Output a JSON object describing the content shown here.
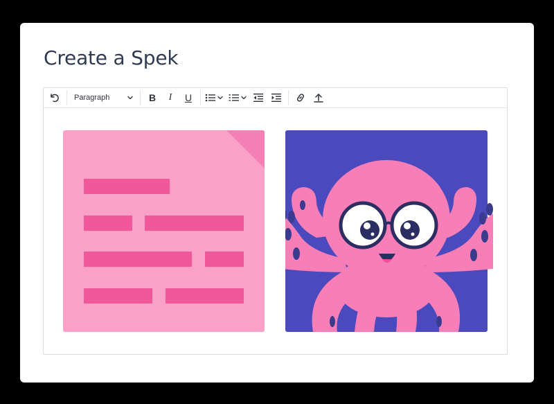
{
  "page": {
    "title": "Create a Spek"
  },
  "toolbar": {
    "items": {
      "undo": "undo-icon",
      "block_format": "Paragraph",
      "bold": "B",
      "italic": "I",
      "underline": "U",
      "bullet_list": "bullet-list-icon",
      "numbered_list": "numbered-list-icon",
      "outdent": "outdent-icon",
      "indent": "indent-icon",
      "link": "link-icon",
      "upload": "upload-icon"
    }
  },
  "colors": {
    "background": "#000000",
    "card": "#ffffff",
    "title": "#2d3a4f",
    "doc_bg": "#fba1c8",
    "doc_lines": "#f1589a",
    "octo_bg": "#4a49bd",
    "octo_body": "#f77eb6"
  }
}
